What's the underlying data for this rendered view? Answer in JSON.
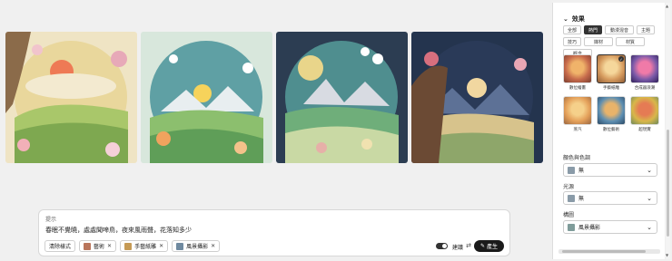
{
  "gallery": {
    "images": [
      {
        "name": "paper-art-1",
        "sky": "#e9d79c",
        "sun": "#ee7a55",
        "hill": "#a9c76a"
      },
      {
        "name": "paper-art-2",
        "sky": "#5fa0a4",
        "sun": "#f6d35b",
        "hill": "#8cbf6e"
      },
      {
        "name": "paper-art-3",
        "sky": "#1f3b57",
        "sun": "#e9d58a",
        "hill": "#6fae7a"
      },
      {
        "name": "paper-art-4",
        "sky": "#2a3a58",
        "sun": "#f1d7a0",
        "hill": "#d7c38c"
      }
    ]
  },
  "prompt": {
    "label": "提示",
    "text": "春眠不覺曉，處處聞啼鳥，夜來風雨聲，花落知多少",
    "clear_label": "清除樣式",
    "chips": [
      {
        "label": "藝術",
        "color": "#b9755b"
      },
      {
        "label": "手藝紙雕",
        "color": "#c59a55"
      },
      {
        "label": "風景攝影",
        "color": "#6f8aa0"
      }
    ],
    "toggle_label": "建議",
    "generate_label": "產生"
  },
  "panel": {
    "section_title": "效果",
    "tabs": [
      "全部",
      "熱門",
      "動漫混音",
      "主題",
      "技巧",
      "媒材",
      "材質",
      "概念"
    ],
    "active_tab": "熱門",
    "tiles": [
      {
        "label": "數位繪畫",
        "color": "#c66a4b",
        "selected": false
      },
      {
        "label": "手藝紙雕",
        "color": "#d69b5e",
        "selected": true
      },
      {
        "label": "合成器浪潮",
        "color": "#7a5aa8",
        "selected": false
      },
      {
        "label": "蒸汽",
        "color": "#e4a05a",
        "selected": false
      },
      {
        "label": "數位藝術",
        "color": "#5e8fb2",
        "selected": false
      },
      {
        "label": "超現實",
        "color": "#d8b74a",
        "selected": false
      }
    ],
    "color_label": "顏色與色調",
    "color_value": "無",
    "light_label": "光源",
    "light_value": "無",
    "comp_label": "構圖",
    "comp_value": "風景攝影"
  }
}
